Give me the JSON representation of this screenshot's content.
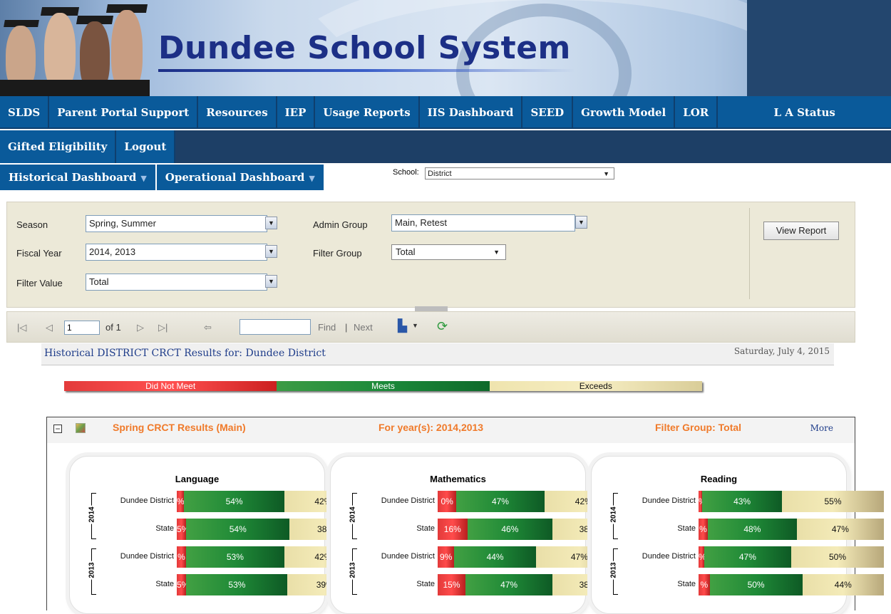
{
  "banner": {
    "title": "Dundee School System"
  },
  "nav": {
    "row1": [
      "SLDS",
      "Parent Portal Support",
      "Resources",
      "IEP",
      "Usage Reports",
      "IIS Dashboard",
      "SEED",
      "Growth Model",
      "LOR",
      "L A Status"
    ],
    "row2": [
      "Gifted Eligibility",
      "Logout"
    ]
  },
  "dashboards": {
    "historical": "Historical Dashboard",
    "operational": "Operational Dashboard"
  },
  "school": {
    "label": "School:",
    "value": "District"
  },
  "params": {
    "season_label": "Season",
    "season_value": "Spring, Summer",
    "fiscal_label": "Fiscal Year",
    "fiscal_value": "2014, 2013",
    "filter_value_label": "Filter Value",
    "filter_value_value": "Total",
    "admin_label": "Admin Group",
    "admin_value": "Main, Retest",
    "filter_group_label": "Filter Group",
    "filter_group_value": "Total",
    "view_report": "View Report"
  },
  "toolbar": {
    "page": "1",
    "of": "of 1",
    "find": "Find",
    "sep": "|",
    "next": "Next"
  },
  "report": {
    "title": "Historical  DISTRICT CRCT Results for: Dundee District",
    "date": "Saturday, July 4, 2015"
  },
  "legend": {
    "did_not_meet": "Did Not Meet",
    "meets": "Meets",
    "exceeds": "Exceeds"
  },
  "panel": {
    "title": "Spring CRCT Results (Main)",
    "years": "For year(s): 2014,2013",
    "filter": "Filter Group: Total",
    "more": "More"
  },
  "colors": {
    "did_not_meet": "#e23a3a",
    "meets": "#1f8a37",
    "exceeds": "#efe4ae",
    "accent": "#f07a2a",
    "nav": "#0a5a9a"
  },
  "chart_data": [
    {
      "type": "bar",
      "title": "Language",
      "groups": [
        "2014",
        "2014",
        "2013",
        "2013"
      ],
      "categories": [
        "Dundee District",
        "State",
        "Dundee District",
        "State"
      ],
      "series": [
        {
          "name": "Did Not Meet",
          "values": [
            4,
            5,
            5,
            5
          ],
          "labels": [
            "%",
            "5%",
            "%",
            "5%"
          ]
        },
        {
          "name": "Meets",
          "values": [
            54,
            54,
            53,
            53
          ],
          "labels": [
            "54%",
            "54%",
            "53%",
            "53%"
          ]
        },
        {
          "name": "Exceeds",
          "values": [
            42,
            38,
            42,
            39
          ],
          "labels": [
            "42%",
            "38%",
            "42%",
            "39%"
          ]
        }
      ]
    },
    {
      "type": "bar",
      "title": "Mathematics",
      "groups": [
        "2014",
        "2014",
        "2013",
        "2013"
      ],
      "categories": [
        "Dundee District",
        "State",
        "Dundee District",
        "State"
      ],
      "series": [
        {
          "name": "Did Not Meet",
          "values": [
            10,
            16,
            9,
            15
          ],
          "labels": [
            "0%",
            "16%",
            "9%",
            "15%"
          ]
        },
        {
          "name": "Meets",
          "values": [
            47,
            46,
            44,
            47
          ],
          "labels": [
            "47%",
            "46%",
            "44%",
            "47%"
          ]
        },
        {
          "name": "Exceeds",
          "values": [
            42,
            38,
            47,
            38
          ],
          "labels": [
            "42%",
            "38%",
            "47%",
            "38%"
          ]
        }
      ]
    },
    {
      "type": "bar",
      "title": "Reading",
      "groups": [
        "2014",
        "2014",
        "2013",
        "2013"
      ],
      "categories": [
        "Dundee District",
        "State",
        "Dundee District",
        "State"
      ],
      "series": [
        {
          "name": "Did Not Meet",
          "values": [
            2,
            5,
            3,
            6
          ],
          "labels": [
            "%",
            "%",
            "%",
            "%"
          ]
        },
        {
          "name": "Meets",
          "values": [
            43,
            48,
            47,
            50
          ],
          "labels": [
            "43%",
            "48%",
            "47%",
            "50%"
          ]
        },
        {
          "name": "Exceeds",
          "values": [
            55,
            47,
            50,
            44
          ],
          "labels": [
            "55%",
            "47%",
            "50%",
            "44%"
          ]
        }
      ]
    }
  ]
}
